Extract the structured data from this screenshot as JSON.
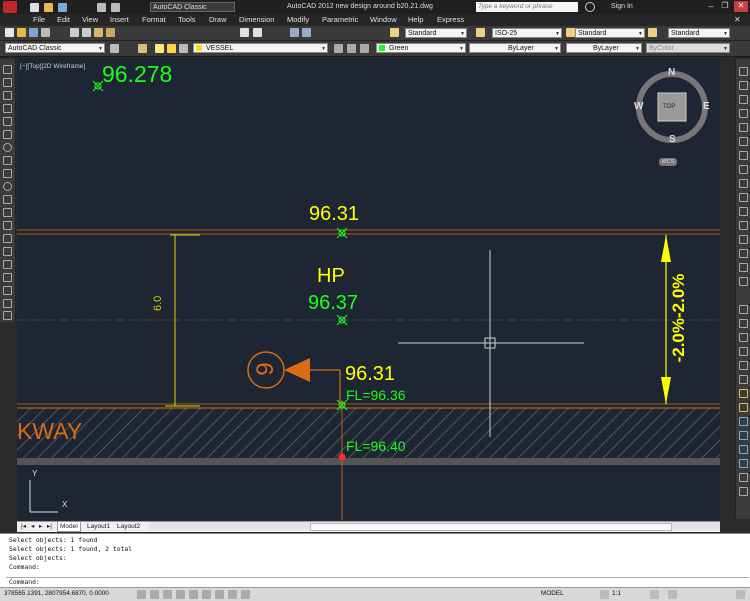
{
  "titlebar": {
    "workspace": "AutoCAD Classic",
    "title": "AutoCAD 2012    new design around b20,21.dwg",
    "search_placeholder": "Type a keyword or phrase",
    "signin": "Sign In"
  },
  "menu": [
    "File",
    "Edit",
    "View",
    "Insert",
    "Format",
    "Tools",
    "Draw",
    "Dimension",
    "Modify",
    "Parametric",
    "Window",
    "Help",
    "Express"
  ],
  "toolbar": {
    "text_style": "Standard",
    "dim_style": "ISO-25",
    "table_style": "Standard",
    "multileader_style": "Standard",
    "workspace": "AutoCAD Classic",
    "layer": "VESSEL",
    "color": "Green",
    "linetype": "ByLayer",
    "lineweight": "ByLayer",
    "plotstyle": "ByColor"
  },
  "viewport": {
    "label": "[−][Top][2D Wireframe]",
    "viewcube": {
      "n": "N",
      "s": "S",
      "e": "E",
      "w": "W",
      "top": "TOP",
      "wcs": "WCS"
    },
    "ucs": {
      "x": "X",
      "y": "Y"
    }
  },
  "drawing": {
    "level_top": "96.278",
    "level_1": "96.31",
    "hp_label": "HP",
    "hp_level": "96.37",
    "dim_value": "6.0",
    "level_2": "96.31",
    "fl_1": "FL=96.36",
    "fl_2": "FL=96.40",
    "walkway": "KWAY",
    "slope": "-2.0%-2.0%",
    "bubble": "9"
  },
  "tabs": [
    "Model",
    "Layout1",
    "Layout2"
  ],
  "command": {
    "lines": [
      "Select objects: 1 found",
      "Select objects: 1 found, 2 total",
      "Select objects:",
      "Command:"
    ],
    "prompt": "Command:"
  },
  "status": {
    "coords": "378565.1391, 2807954.6870, 0.0000",
    "model": "MODEL",
    "scale": "1:1"
  },
  "colors": {
    "canvas": "#1e2533",
    "green": "#1aff1a",
    "yellow": "#ffff00",
    "orange": "#d96c14"
  }
}
